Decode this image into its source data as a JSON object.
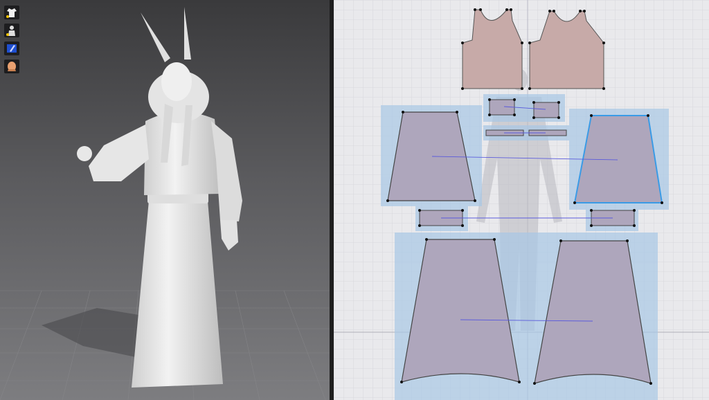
{
  "toolbar": [
    {
      "name": "garment-icon"
    },
    {
      "name": "avatar-icon"
    },
    {
      "name": "tool-icon"
    },
    {
      "name": "head-icon"
    }
  ],
  "colors": {
    "pattern_bg": "#e9e9ec",
    "grid": "#d4d4da",
    "piece_fill": "#aea6bc",
    "bodice_fill": "#c7aaa8",
    "selection_fill": "#a8c8e6",
    "selected_outline": "#3a9be6",
    "sewing_line": "#5a5adc"
  }
}
